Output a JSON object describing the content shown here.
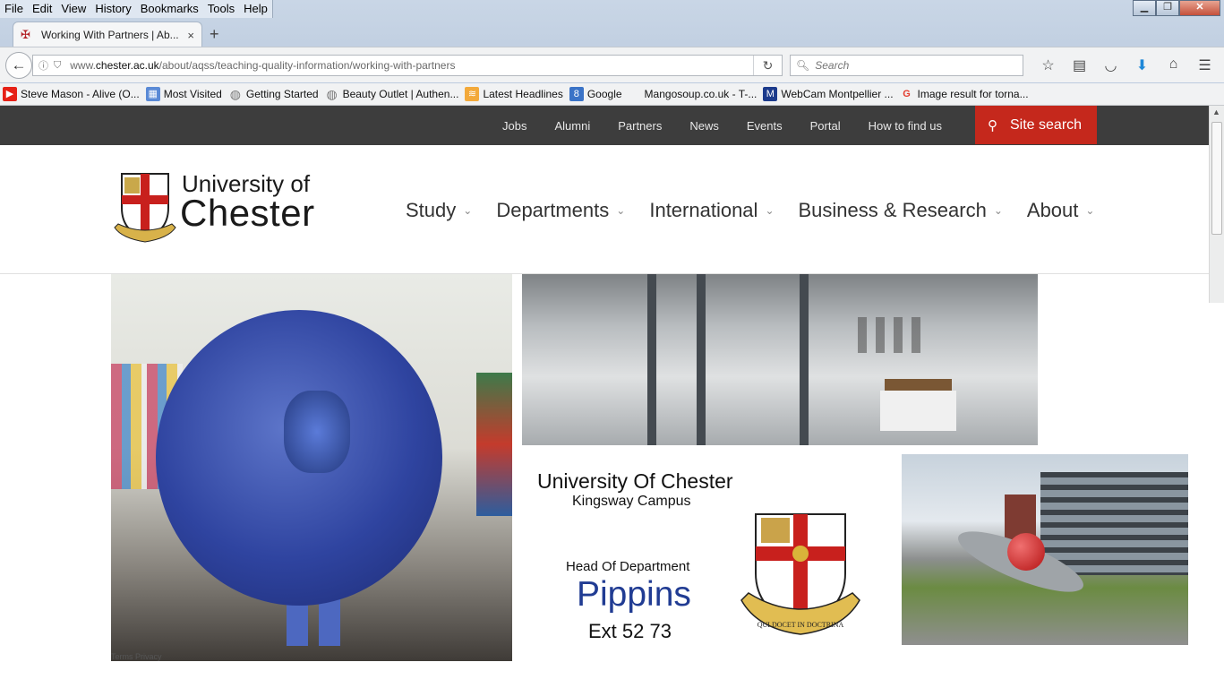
{
  "browser": {
    "menu": [
      "File",
      "Edit",
      "View",
      "History",
      "Bookmarks",
      "Tools",
      "Help"
    ],
    "window_buttons": {
      "minimize": "▁",
      "restore": "❐",
      "close": "✕"
    },
    "tab": {
      "title": "Working With Partners | Ab...",
      "close": "×",
      "new_tab": "+"
    },
    "url": {
      "prefix": "www.",
      "domain": "chester.ac.uk",
      "path": "/about/aqss/teaching-quality-information/working-with-partners"
    },
    "search": {
      "placeholder": "Search"
    },
    "bookmarks": [
      {
        "label": "Steve Mason - Alive (O...",
        "icon": "youtube-icon"
      },
      {
        "label": "Most Visited",
        "icon": "most-visited-icon"
      },
      {
        "label": "Getting Started",
        "icon": "globe-icon"
      },
      {
        "label": "Beauty Outlet | Authen...",
        "icon": "globe-icon"
      },
      {
        "label": "Latest Headlines",
        "icon": "rss-icon"
      },
      {
        "label": "Google",
        "icon": "google-8-icon"
      },
      {
        "label": "Mangosoup.co.uk - T-...",
        "icon": "blank-icon"
      },
      {
        "label": "WebCam Montpellier ...",
        "icon": "m-icon"
      },
      {
        "label": "Image result for torna...",
        "icon": "google-icon"
      }
    ]
  },
  "site": {
    "util_links": [
      "Jobs",
      "Alumni",
      "Partners",
      "News",
      "Events",
      "Portal",
      "How to find us"
    ],
    "site_search": "Site search",
    "logo": {
      "line1": "University of",
      "line2": "Chester"
    },
    "main_nav": [
      "Study",
      "Departments",
      "International",
      "Business & Research",
      "About"
    ],
    "hero_footer": "Terms    Privacy",
    "info": {
      "title": "University Of Chester",
      "campus": "Kingsway Campus",
      "role": "Head Of Department",
      "name": "Pippins",
      "ext": "Ext 52 73",
      "crest_motto": "QUI DOCET IN DOCTRINA"
    }
  },
  "colors": {
    "brand_red": "#c5281c",
    "util_bar": "#3d3d3d",
    "name_blue": "#213c93"
  }
}
